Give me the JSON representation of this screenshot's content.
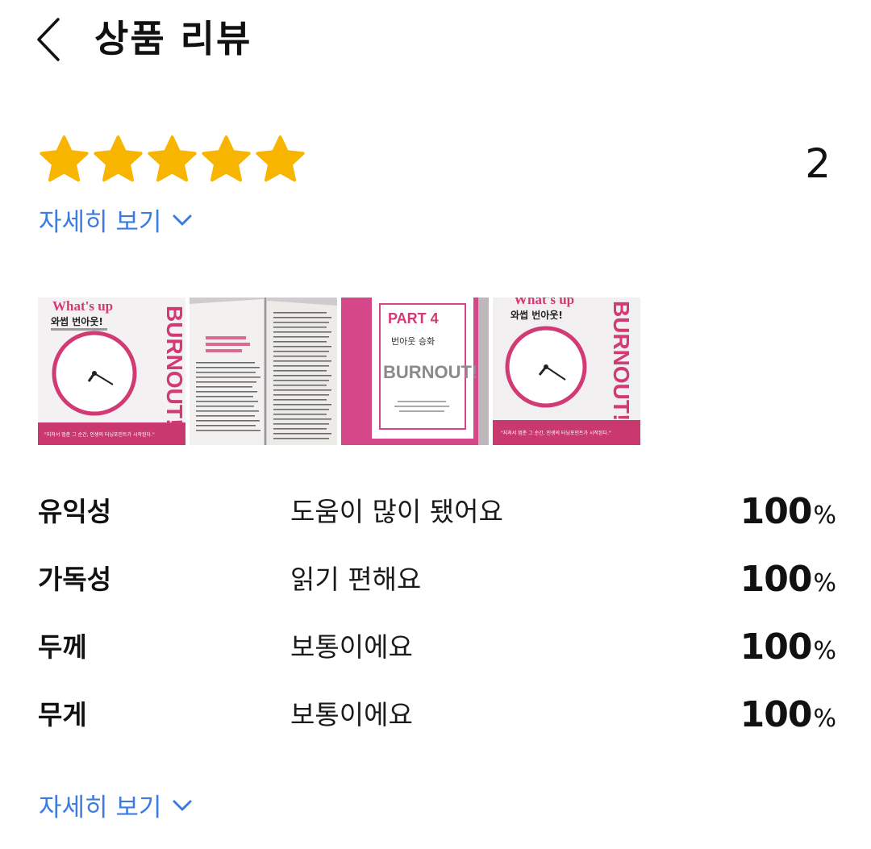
{
  "header": {
    "title": "상품 리뷰",
    "back_icon": "chevron-left-icon"
  },
  "rating": {
    "stars": 5,
    "max_stars": 5,
    "star_color": "#f7b500",
    "count": "2"
  },
  "more_link_top": {
    "label": "자세히 보기",
    "color": "#3d7be0"
  },
  "photos": [
    {
      "name": "photo-book-cover",
      "title": "What's up",
      "subtitle": "와썹 번아웃!",
      "spine": "BURNOUT!",
      "quote": "\"지쳐서 멈춘 그 순간, 인생의 터닝포인트가 시작된다.\""
    },
    {
      "name": "photo-book-pages"
    },
    {
      "name": "photo-book-part4",
      "part": "PART 4",
      "heading": "번아웃 승화",
      "word": "BURNOUT!"
    },
    {
      "name": "photo-book-cover-2",
      "title": "What's up",
      "subtitle": "와썹 번아웃!",
      "spine": "BURNOUT!",
      "quote": "\"지쳐서 멈춘 그 순간, 인생의 터닝포인트가 시작된다.\""
    }
  ],
  "stats": [
    {
      "label": "유익성",
      "value": "도움이 많이 됐어요",
      "percent": "100",
      "unit": "%"
    },
    {
      "label": "가독성",
      "value": "읽기 편해요",
      "percent": "100",
      "unit": "%"
    },
    {
      "label": "두께",
      "value": "보통이에요",
      "percent": "100",
      "unit": "%"
    },
    {
      "label": "무게",
      "value": "보통이에요",
      "percent": "100",
      "unit": "%"
    }
  ],
  "more_link_bottom": {
    "label": "자세히 보기",
    "color": "#3d7be0"
  }
}
